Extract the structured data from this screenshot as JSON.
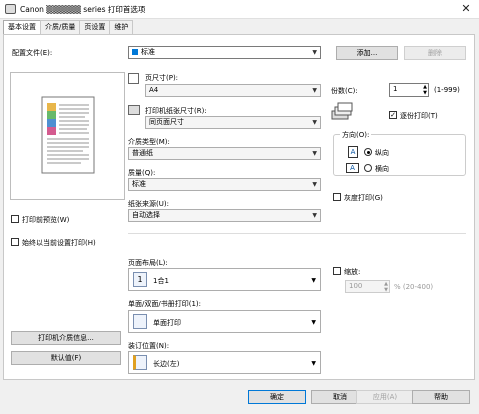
{
  "window": {
    "title": "Canon  ▒▒▒▒▒▒  series 打印首选项",
    "close": "✕"
  },
  "tabs": [
    "基本设置",
    "介质/质量",
    "页设置",
    "维护"
  ],
  "profile": {
    "label": "配置文件(E):",
    "value": "标准",
    "add": "添加...",
    "delete": "删除"
  },
  "page_size": {
    "label": "页尺寸(P):",
    "value": "A4"
  },
  "paper_size": {
    "label": "打印机纸张尺寸(R):",
    "value": "同页面尺寸"
  },
  "media": {
    "label": "介质类型(M):",
    "value": "普通纸"
  },
  "quality": {
    "label": "质量(Q):",
    "value": "标准"
  },
  "source": {
    "label": "纸张来源(U):",
    "value": "自动选择"
  },
  "copies": {
    "label": "份数(C):",
    "value": "1",
    "range": "(1-999)",
    "collate": "逐份打印(T)"
  },
  "orientation": {
    "label": "方向(O):",
    "portrait": "纵向",
    "landscape": "横向"
  },
  "grayscale": "灰度打印(G)",
  "preview_before": "打印前预览(W)",
  "print_current": "始终以当前设置打印(H)",
  "layout": {
    "label": "页面布局(L):",
    "value": "1合1"
  },
  "duplex": {
    "label": "单面/双面/书册打印(1):",
    "value": "单面打印"
  },
  "binding": {
    "label": "装订位置(N):",
    "value": "长边(左)"
  },
  "scale": {
    "label": "缩放:",
    "value": "100",
    "range": "% (20-400)"
  },
  "media_info": "打印机介质信息...",
  "defaults": "默认值(F)",
  "footer": {
    "ok": "确定",
    "cancel": "取消",
    "apply": "应用(A)",
    "help": "帮助"
  },
  "colors": {
    "accent": "#0078d7",
    "border": "#adadad"
  }
}
